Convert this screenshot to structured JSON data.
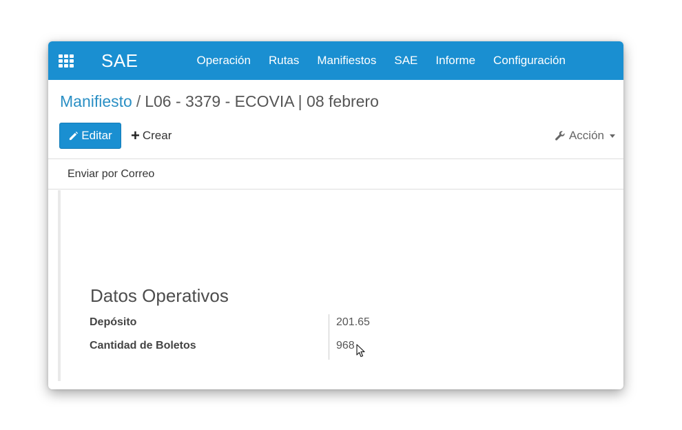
{
  "topbar": {
    "brand": "SAE",
    "menu": [
      "Operación",
      "Rutas",
      "Manifiestos",
      "SAE",
      "Informe",
      "Configuración"
    ],
    "apps_icon": "apps-grid-icon"
  },
  "breadcrumb": {
    "parent": "Manifiesto",
    "separator": "/",
    "current": "L06 - 3379 - ECOVIA | 08 febrero"
  },
  "toolbar": {
    "edit_label": "Editar",
    "edit_icon": "pencil-icon",
    "create_label": "Crear",
    "create_icon": "plus-icon",
    "action_label": "Acción",
    "action_icon": "wrench-icon"
  },
  "statusbar": {
    "email_label": "Enviar por Correo"
  },
  "form": {
    "section_title": "Datos Operativos",
    "fields": [
      {
        "label": "Depósito",
        "value": "201.65"
      },
      {
        "label": "Cantidad de Boletos",
        "value": "968"
      }
    ]
  },
  "colors": {
    "primary": "#1a8fd1",
    "link": "#2a8fc4"
  }
}
